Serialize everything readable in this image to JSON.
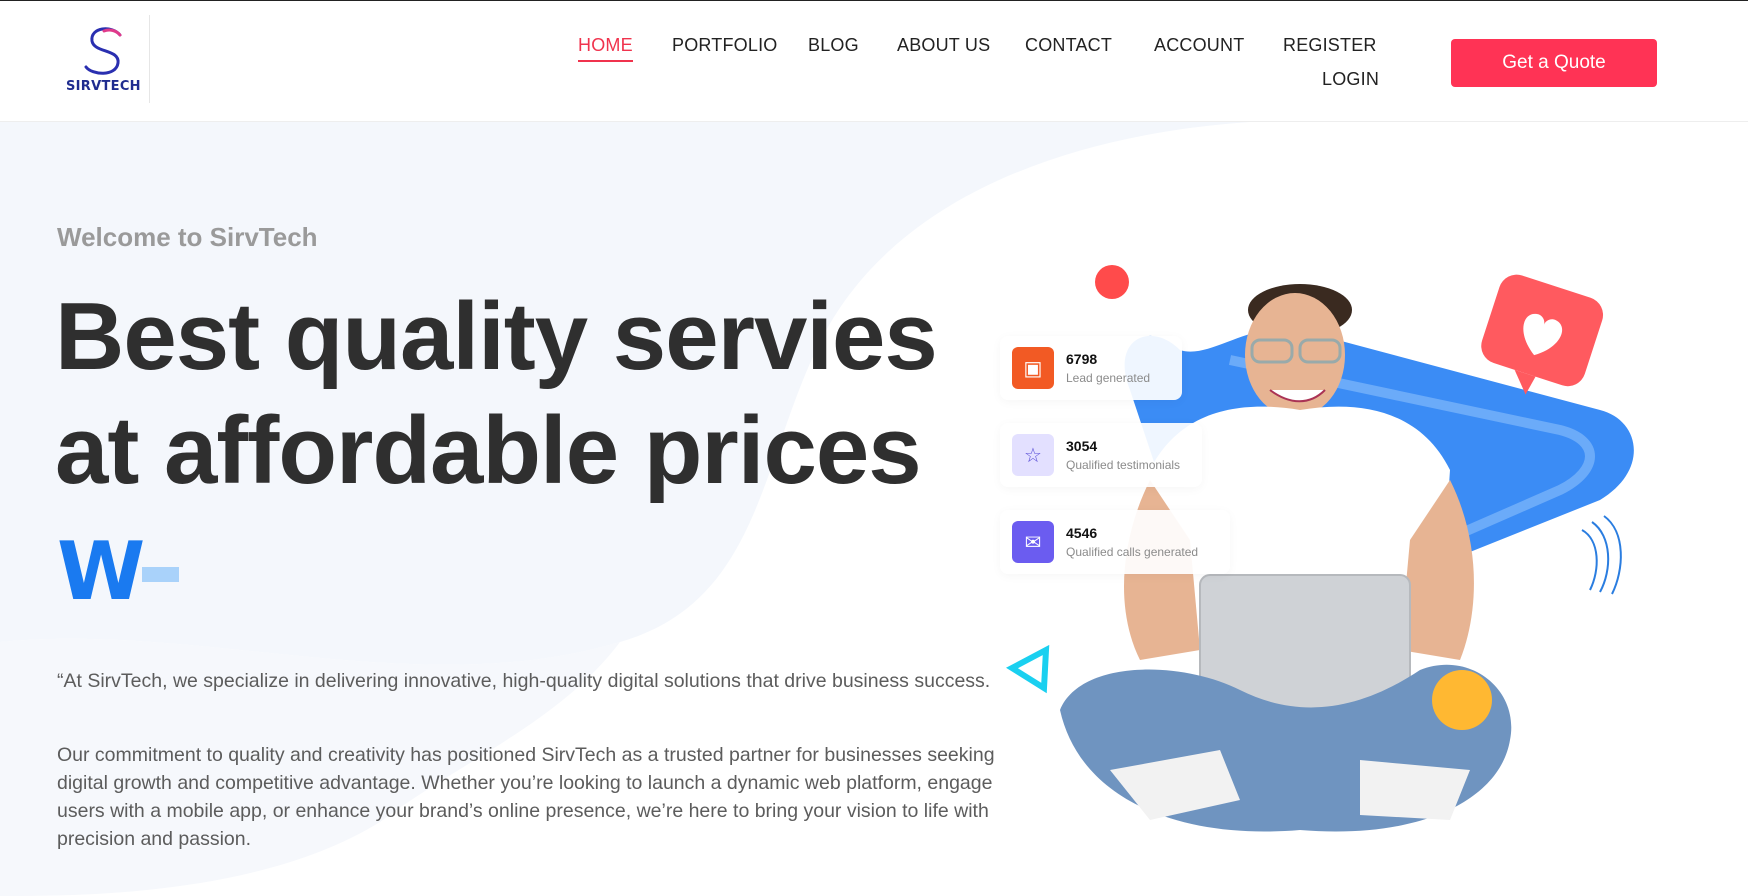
{
  "brand": {
    "name": "SIRVTECH"
  },
  "nav": {
    "items": [
      "HOME",
      "PORTFOLIO",
      "BLOG",
      "ABOUT US",
      "CONTACT",
      "ACCOUNT",
      "REGISTER",
      "LOGIN"
    ],
    "active": "HOME",
    "cta": "Get a Quote"
  },
  "hero": {
    "welcome": "Welcome to SirvTech",
    "headline_line1": "Best quality servies",
    "headline_line2": "at affordable prices",
    "typed_text": "W",
    "paragraph1": "“At SirvTech, we specialize in delivering innovative, high-quality digital solutions that drive business success.",
    "paragraph2": "Our commitment to quality and creativity has positioned SirvTech as a trusted partner for businesses seeking digital growth and competitive advantage. Whether you’re looking to launch a dynamic web platform, engage users with a mobile app, or enhance your brand’s online presence, we’re here to bring your vision to life with precision and passion."
  },
  "stats": [
    {
      "number": "6798",
      "label": "Lead generated",
      "icon": "monitor-gear-icon",
      "color": "#f25a24"
    },
    {
      "number": "3054",
      "label": "Qualified testimonials",
      "icon": "user-stars-icon",
      "color": "#e3e0ff"
    },
    {
      "number": "4546",
      "label": "Qualified calls generated",
      "icon": "chat-bubbles-icon",
      "color": "#6b5cf0"
    }
  ],
  "colors": {
    "accent": "#f0334d",
    "cta": "#ff3355",
    "typed": "#1a7af0",
    "blob": "#3b8cf5"
  }
}
